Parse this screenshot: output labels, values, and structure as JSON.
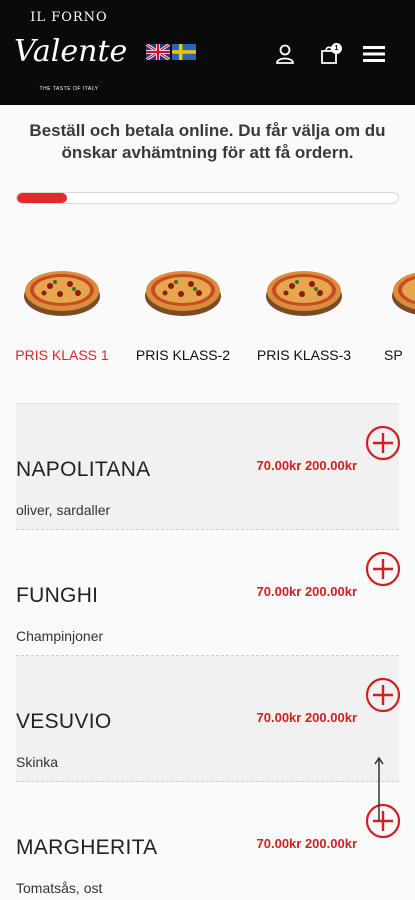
{
  "header": {
    "logo": {
      "top": "IL FORNO",
      "script": "Valente",
      "tagline": "THE TASTE OF ITALY"
    },
    "languages": [
      "English",
      "Svenska"
    ],
    "cart_count": "1"
  },
  "intro": "Beställ och betala online. Du får välja om du önskar avhämtning för att få ordern.",
  "progress": {
    "value": 0.13
  },
  "categories": [
    {
      "label": "PRIS KLASS 1"
    },
    {
      "label": "PRIS KLASS-2"
    },
    {
      "label": "PRIS KLASS-3"
    },
    {
      "label": "SP"
    }
  ],
  "menu": [
    {
      "name": "NAPOLITANA",
      "prices": "70.00kr 200.00kr",
      "desc": "oliver, sardaller"
    },
    {
      "name": "FUNGHI",
      "prices": "70.00kr 200.00kr",
      "desc": "Champinjoner"
    },
    {
      "name": "VESUVIO",
      "prices": "70.00kr 200.00kr",
      "desc": "Skinka"
    },
    {
      "name": "MARGHERITA",
      "prices": "70.00kr 200.00kr",
      "desc": "Tomatsås, ost"
    }
  ],
  "colors": {
    "header_bg": "#0a0a0a",
    "accent": "#d62a2a"
  }
}
